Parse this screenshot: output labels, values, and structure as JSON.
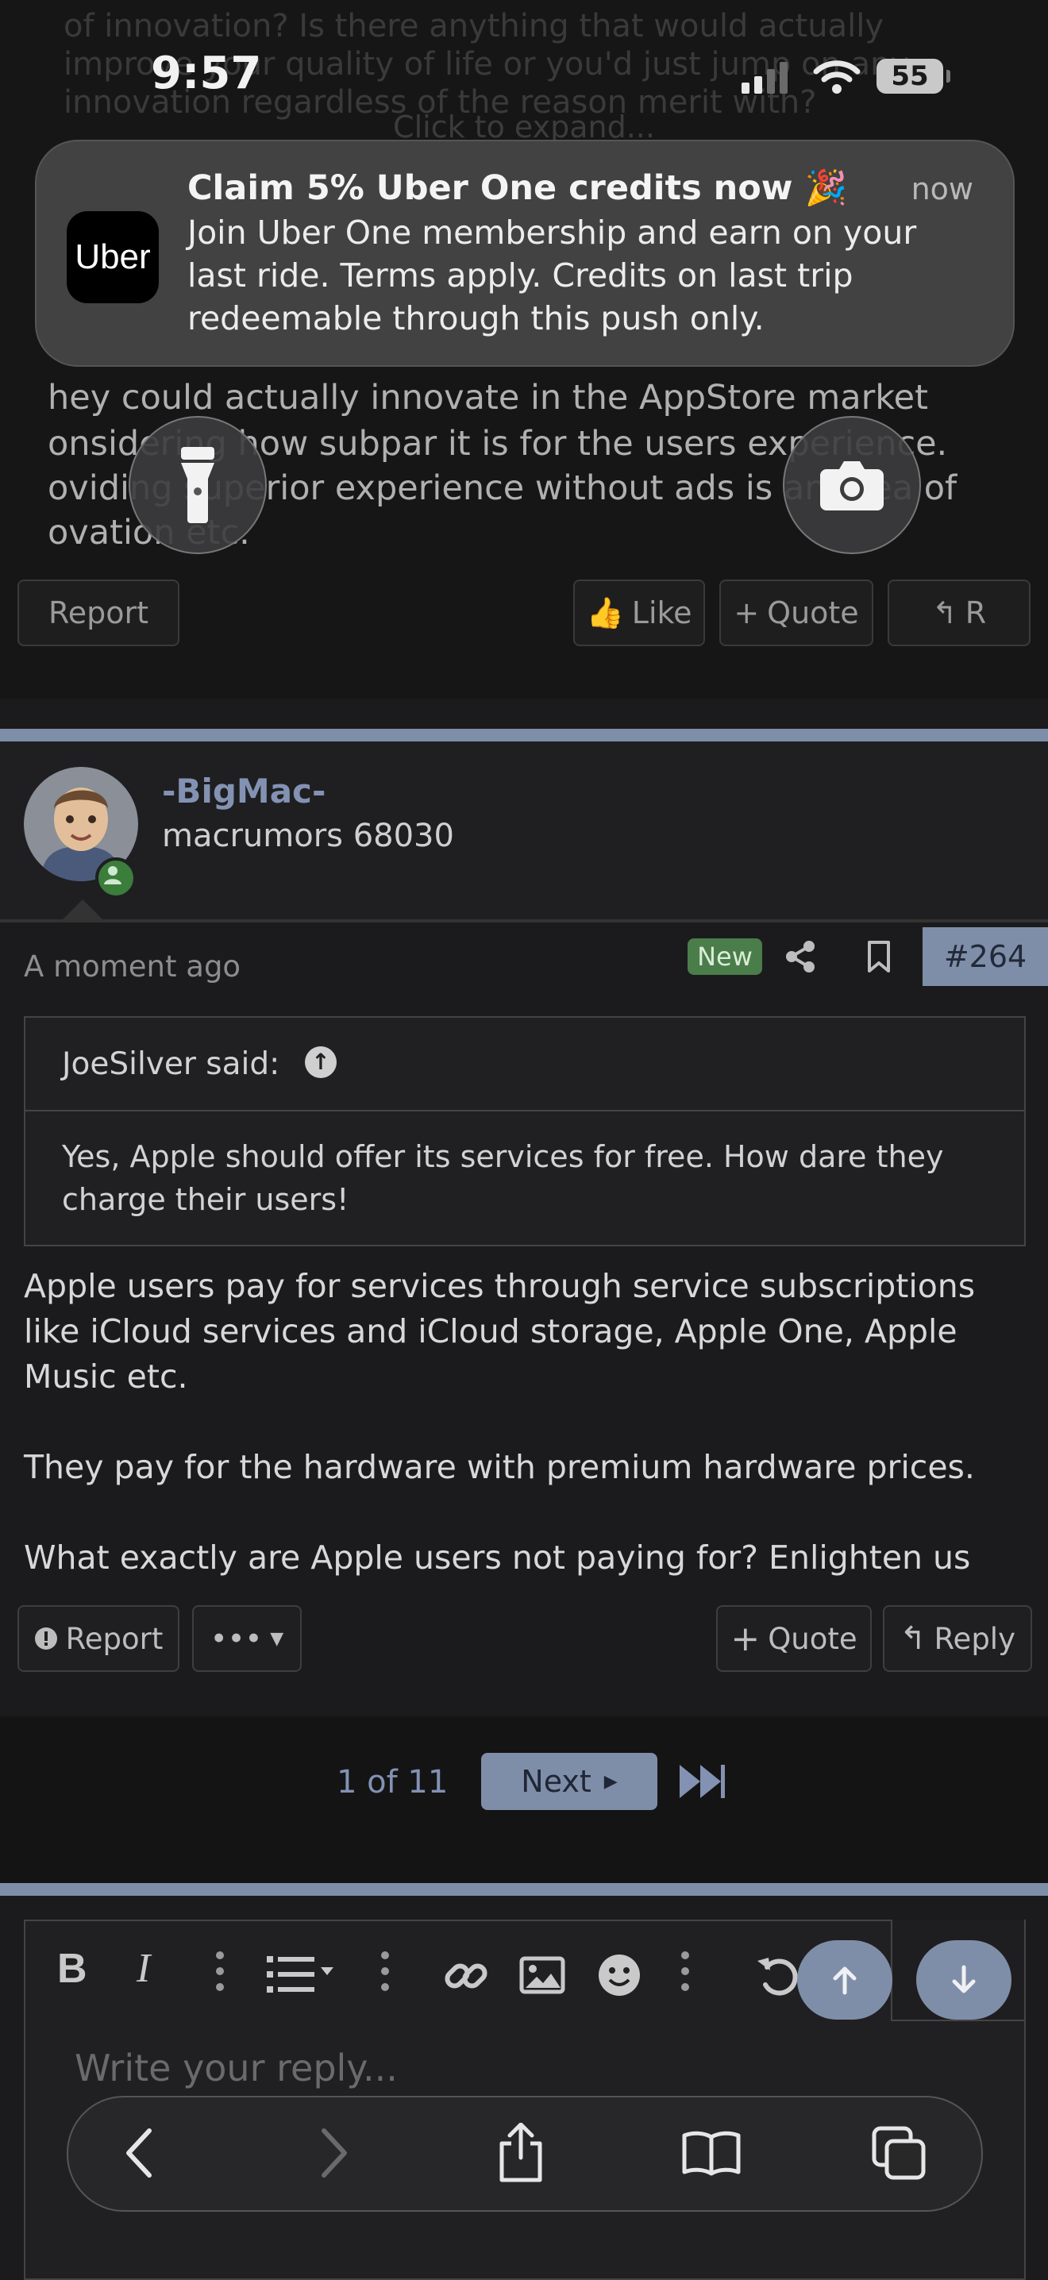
{
  "status_bar": {
    "time": "9:57",
    "battery": "55"
  },
  "background_post": {
    "faded_lines": [
      "of innovation? Is there anything that would actually",
      "improve your quality of life or you'd just jump on any",
      "innovation regardless of the reason merit with?"
    ],
    "expand_hint": "Click to expand...",
    "lines": [
      "hey could actually innovate in the AppStore market",
      "onsidering how subpar it is for the users experience.",
      "oviding superior experience without ads is an area of",
      "ovation etc."
    ],
    "buttons": {
      "report": "Report",
      "like": "Like",
      "quote": "Quote",
      "reply": "R"
    }
  },
  "notification": {
    "app_logo": "Uber",
    "title": "Claim 5% Uber One credits now 🎉",
    "time": "now",
    "body": "Join Uber One membership and earn on your last ride. Terms apply. Credits on last trip redeemable through this push only."
  },
  "lockscreen_icons": {
    "left": "flashlight-icon",
    "right": "camera-icon"
  },
  "post": {
    "username": "-BigMac-",
    "user_title": "macrumors 68030",
    "timestamp": "A moment ago",
    "badge": "New",
    "post_number": "#264",
    "quote": {
      "author": "JoeSilver said:",
      "text": "Yes, Apple should offer its services for free. How dare they charge their users!"
    },
    "paragraphs": [
      "Apple users pay for services through service subscriptions like iCloud services and iCloud storage, Apple One, Apple Music etc.",
      "They pay for the hardware with premium hardware prices.",
      "What exactly are Apple users not paying for? Enlighten us"
    ],
    "actions": {
      "report": "Report",
      "more": "•••",
      "quote": "Quote",
      "reply": "Reply"
    }
  },
  "pagination": {
    "count": "1 of 11",
    "next": "Next"
  },
  "editor": {
    "placeholder": "Write your reply..."
  },
  "colors": {
    "accent": "#7f8ea8",
    "badge_green": "#4a7d4a",
    "background": "#1b1b1d"
  }
}
